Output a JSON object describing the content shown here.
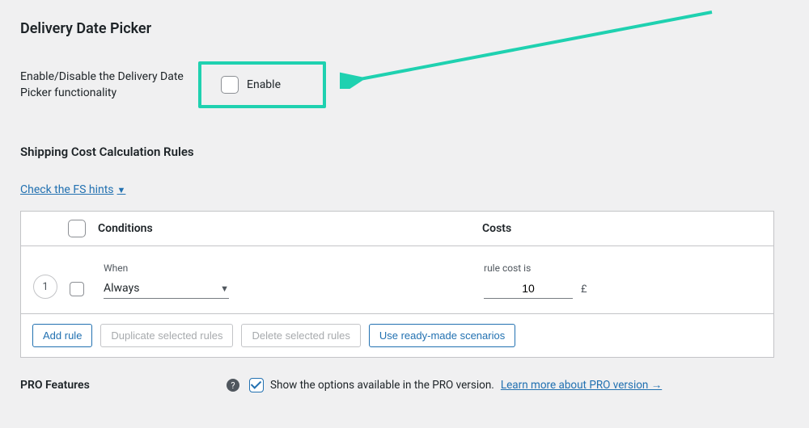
{
  "sections": {
    "delivery_picker_title": "Delivery Date Picker",
    "enable_label": "Enable/Disable the Delivery Date Picker functionality",
    "enable_checkbox_text": "Enable",
    "shipping_rules_title": "Shipping Cost Calculation Rules",
    "hints_link": "Check the FS hints",
    "table": {
      "header_conditions": "Conditions",
      "header_costs": "Costs",
      "rows": [
        {
          "index": "1",
          "when_label": "When",
          "when_value": "Always",
          "cost_label": "rule cost is",
          "cost_value": "10",
          "currency": "£"
        }
      ]
    },
    "buttons": {
      "add_rule": "Add rule",
      "duplicate": "Duplicate selected rules",
      "delete": "Delete selected rules",
      "scenarios": "Use ready-made scenarios"
    },
    "pro": {
      "label": "PRO Features",
      "help": "?",
      "text": "Show the options available in the PRO version.",
      "link": "Learn more about PRO version →"
    }
  }
}
